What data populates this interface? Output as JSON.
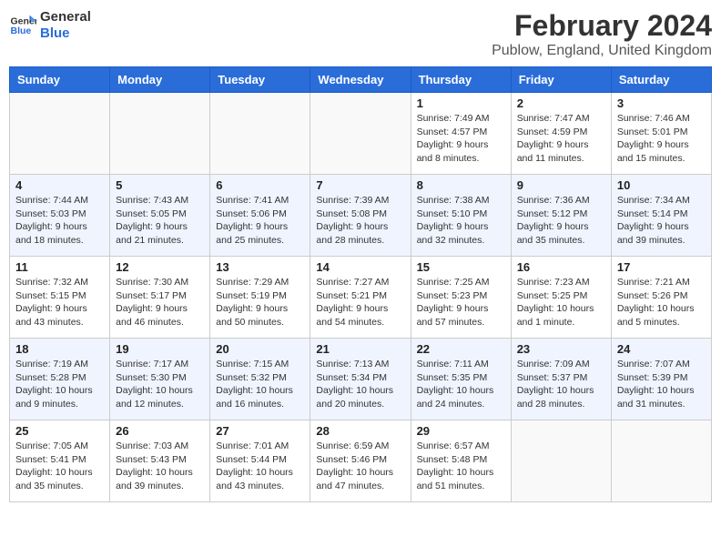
{
  "logo": {
    "line1": "General",
    "line2": "Blue"
  },
  "title": "February 2024",
  "location": "Publow, England, United Kingdom",
  "days_of_week": [
    "Sunday",
    "Monday",
    "Tuesday",
    "Wednesday",
    "Thursday",
    "Friday",
    "Saturday"
  ],
  "weeks": [
    [
      {
        "day": "",
        "info": ""
      },
      {
        "day": "",
        "info": ""
      },
      {
        "day": "",
        "info": ""
      },
      {
        "day": "",
        "info": ""
      },
      {
        "day": "1",
        "info": "Sunrise: 7:49 AM\nSunset: 4:57 PM\nDaylight: 9 hours\nand 8 minutes."
      },
      {
        "day": "2",
        "info": "Sunrise: 7:47 AM\nSunset: 4:59 PM\nDaylight: 9 hours\nand 11 minutes."
      },
      {
        "day": "3",
        "info": "Sunrise: 7:46 AM\nSunset: 5:01 PM\nDaylight: 9 hours\nand 15 minutes."
      }
    ],
    [
      {
        "day": "4",
        "info": "Sunrise: 7:44 AM\nSunset: 5:03 PM\nDaylight: 9 hours\nand 18 minutes."
      },
      {
        "day": "5",
        "info": "Sunrise: 7:43 AM\nSunset: 5:05 PM\nDaylight: 9 hours\nand 21 minutes."
      },
      {
        "day": "6",
        "info": "Sunrise: 7:41 AM\nSunset: 5:06 PM\nDaylight: 9 hours\nand 25 minutes."
      },
      {
        "day": "7",
        "info": "Sunrise: 7:39 AM\nSunset: 5:08 PM\nDaylight: 9 hours\nand 28 minutes."
      },
      {
        "day": "8",
        "info": "Sunrise: 7:38 AM\nSunset: 5:10 PM\nDaylight: 9 hours\nand 32 minutes."
      },
      {
        "day": "9",
        "info": "Sunrise: 7:36 AM\nSunset: 5:12 PM\nDaylight: 9 hours\nand 35 minutes."
      },
      {
        "day": "10",
        "info": "Sunrise: 7:34 AM\nSunset: 5:14 PM\nDaylight: 9 hours\nand 39 minutes."
      }
    ],
    [
      {
        "day": "11",
        "info": "Sunrise: 7:32 AM\nSunset: 5:15 PM\nDaylight: 9 hours\nand 43 minutes."
      },
      {
        "day": "12",
        "info": "Sunrise: 7:30 AM\nSunset: 5:17 PM\nDaylight: 9 hours\nand 46 minutes."
      },
      {
        "day": "13",
        "info": "Sunrise: 7:29 AM\nSunset: 5:19 PM\nDaylight: 9 hours\nand 50 minutes."
      },
      {
        "day": "14",
        "info": "Sunrise: 7:27 AM\nSunset: 5:21 PM\nDaylight: 9 hours\nand 54 minutes."
      },
      {
        "day": "15",
        "info": "Sunrise: 7:25 AM\nSunset: 5:23 PM\nDaylight: 9 hours\nand 57 minutes."
      },
      {
        "day": "16",
        "info": "Sunrise: 7:23 AM\nSunset: 5:25 PM\nDaylight: 10 hours\nand 1 minute."
      },
      {
        "day": "17",
        "info": "Sunrise: 7:21 AM\nSunset: 5:26 PM\nDaylight: 10 hours\nand 5 minutes."
      }
    ],
    [
      {
        "day": "18",
        "info": "Sunrise: 7:19 AM\nSunset: 5:28 PM\nDaylight: 10 hours\nand 9 minutes."
      },
      {
        "day": "19",
        "info": "Sunrise: 7:17 AM\nSunset: 5:30 PM\nDaylight: 10 hours\nand 12 minutes."
      },
      {
        "day": "20",
        "info": "Sunrise: 7:15 AM\nSunset: 5:32 PM\nDaylight: 10 hours\nand 16 minutes."
      },
      {
        "day": "21",
        "info": "Sunrise: 7:13 AM\nSunset: 5:34 PM\nDaylight: 10 hours\nand 20 minutes."
      },
      {
        "day": "22",
        "info": "Sunrise: 7:11 AM\nSunset: 5:35 PM\nDaylight: 10 hours\nand 24 minutes."
      },
      {
        "day": "23",
        "info": "Sunrise: 7:09 AM\nSunset: 5:37 PM\nDaylight: 10 hours\nand 28 minutes."
      },
      {
        "day": "24",
        "info": "Sunrise: 7:07 AM\nSunset: 5:39 PM\nDaylight: 10 hours\nand 31 minutes."
      }
    ],
    [
      {
        "day": "25",
        "info": "Sunrise: 7:05 AM\nSunset: 5:41 PM\nDaylight: 10 hours\nand 35 minutes."
      },
      {
        "day": "26",
        "info": "Sunrise: 7:03 AM\nSunset: 5:43 PM\nDaylight: 10 hours\nand 39 minutes."
      },
      {
        "day": "27",
        "info": "Sunrise: 7:01 AM\nSunset: 5:44 PM\nDaylight: 10 hours\nand 43 minutes."
      },
      {
        "day": "28",
        "info": "Sunrise: 6:59 AM\nSunset: 5:46 PM\nDaylight: 10 hours\nand 47 minutes."
      },
      {
        "day": "29",
        "info": "Sunrise: 6:57 AM\nSunset: 5:48 PM\nDaylight: 10 hours\nand 51 minutes."
      },
      {
        "day": "",
        "info": ""
      },
      {
        "day": "",
        "info": ""
      }
    ]
  ]
}
